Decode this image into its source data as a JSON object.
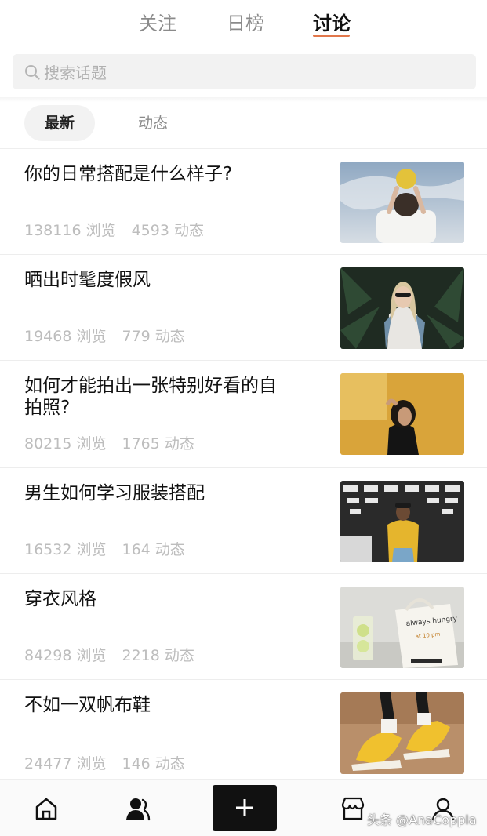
{
  "top_tabs": [
    {
      "label": "关注"
    },
    {
      "label": "日榜"
    },
    {
      "label": "讨论"
    }
  ],
  "search": {
    "placeholder": "搜索话题"
  },
  "sub_tabs": [
    {
      "label": "最新"
    },
    {
      "label": "动态"
    }
  ],
  "topics": [
    {
      "title": "你的日常搭配是什么样子?",
      "views": "138116 浏览",
      "posts": "4593 动态"
    },
    {
      "title": "晒出时髦度假风",
      "views": "19468 浏览",
      "posts": "779 动态"
    },
    {
      "title": "如何才能拍出一张特别好看的自拍照?",
      "views": "80215 浏览",
      "posts": "1765 动态"
    },
    {
      "title": "男生如何学习服装搭配",
      "views": "16532 浏览",
      "posts": "164 动态"
    },
    {
      "title": "穿衣风格",
      "views": "84298 浏览",
      "posts": "2218 动态"
    },
    {
      "title": "不如一双帆布鞋",
      "views": "24477 浏览",
      "posts": "146 动态"
    }
  ],
  "bottom_nav": {
    "icons": [
      "home-icon",
      "friends-icon",
      "plus-icon",
      "store-icon",
      "profile-icon"
    ]
  },
  "watermark": "头条 @AnaCoppla",
  "colors": {
    "accent": "#e2774b",
    "text": "#111111",
    "muted": "#bdbdbd"
  }
}
